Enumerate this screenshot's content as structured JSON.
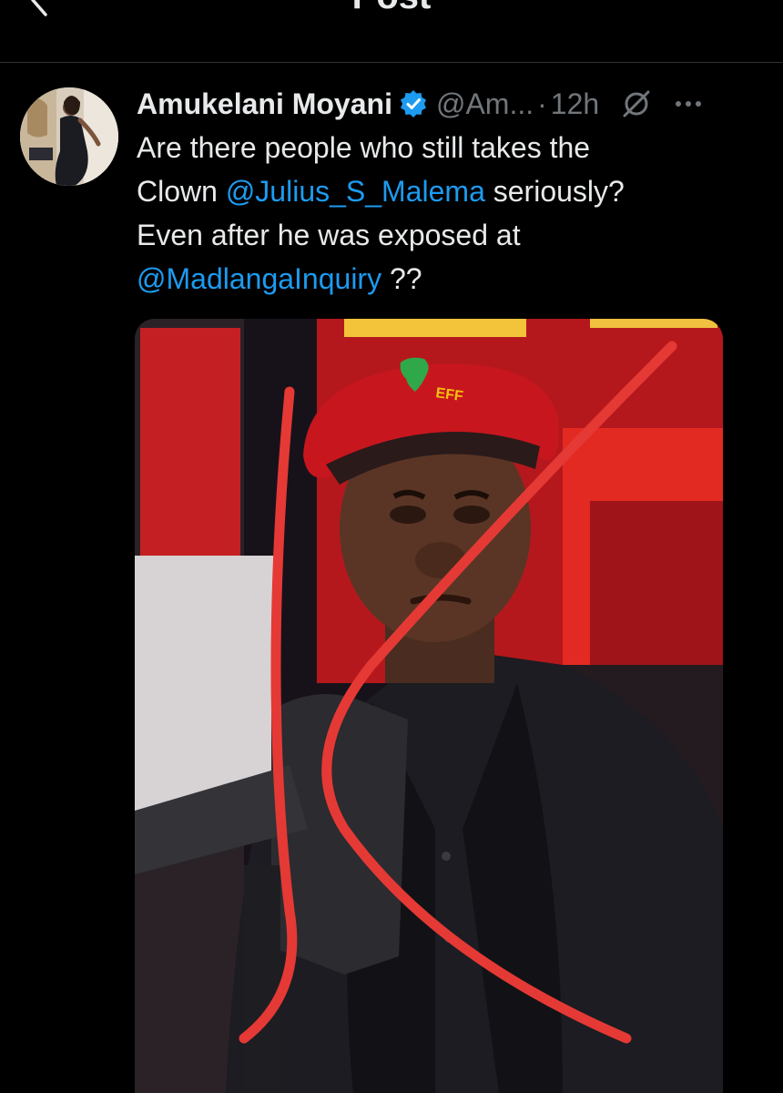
{
  "header": {
    "title": "Post",
    "back_icon": "chevron-left-icon"
  },
  "tweet": {
    "display_name": "Amukelani Moyani",
    "verified_icon": "verified-badge-icon",
    "handle": "@Am...",
    "separator": "·",
    "time": "12h",
    "grok_icon": "grok-icon",
    "more_icon": "more-icon",
    "text": {
      "line1": "Are there people who still takes the",
      "line2_prefix": "Clown ",
      "mention1": "@Julius_S_Malema",
      "line2_suffix": " seriously?",
      "line3": "Even after he was exposed at",
      "mention2": "@MadlangaInquiry",
      "line4_suffix": " ??"
    },
    "media": {
      "cap_text": "EFF"
    }
  },
  "colors": {
    "background": "#000000",
    "text": "#e7e9ea",
    "secondary": "#71767b",
    "link": "#1d9bf0",
    "verified": "#1d9bf0",
    "cross": "#e53935"
  }
}
